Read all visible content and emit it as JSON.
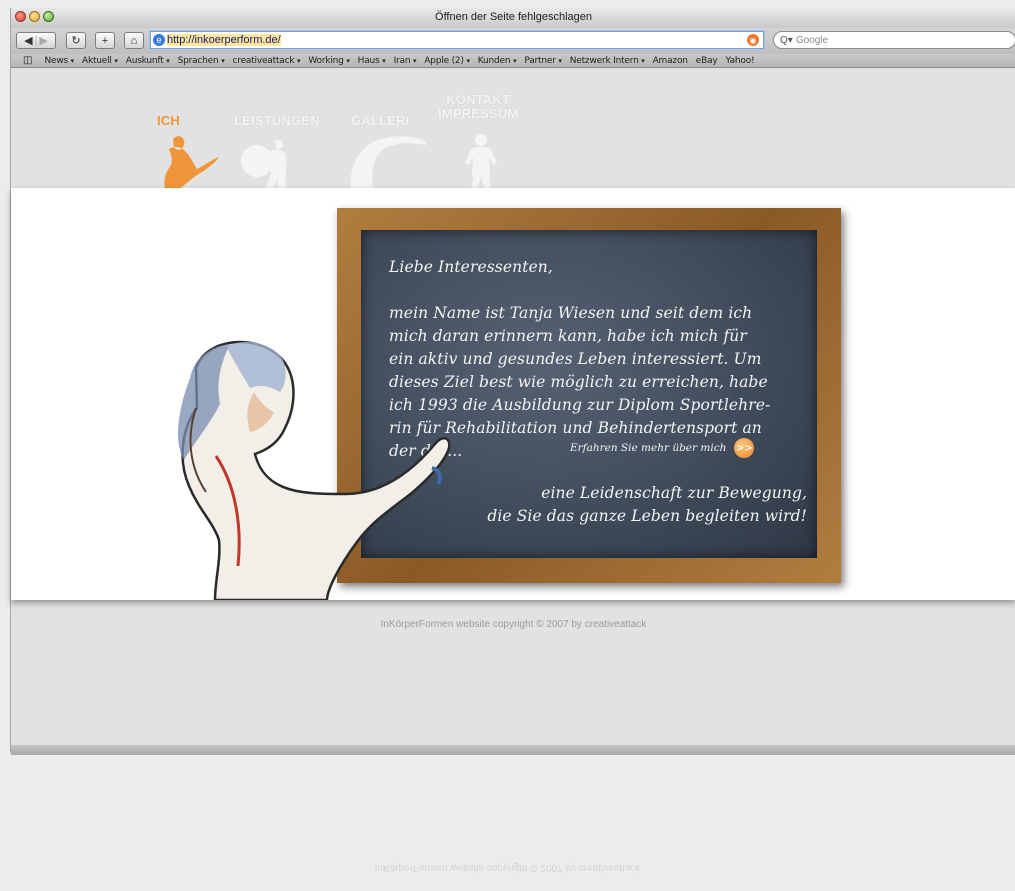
{
  "window": {
    "title": "Öffnen der Seite fehlgeschlagen"
  },
  "toolbar": {
    "url": "http://inkoerperform.de/",
    "search_placeholder": "Google"
  },
  "bookmarks": [
    "News",
    "Aktuell",
    "Auskunft",
    "Sprachen",
    "creativeattack",
    "Working",
    "Haus",
    "Iran",
    "Apple (2)",
    "Kunden",
    "Partner",
    "Netzwerk Intern",
    "Amazon",
    "eBay",
    "Yahoo!"
  ],
  "nav": {
    "ich": "ICH",
    "leistungen": "LEISTUNGEN",
    "galleri": "GALLERI",
    "kontakt": "KONTAKT",
    "impressum": "IMPRESSUM"
  },
  "board": {
    "greeting": "Liebe Interessenten,",
    "lines": [
      "mein Name ist Tanja Wiesen und seit dem ich",
      "mich daran erinnern kann, habe ich mich für",
      "ein aktiv und gesundes Leben interessiert. Um",
      "dieses Ziel best wie möglich zu erreichen, habe",
      "ich 1993 die Ausbildung zur Diplom Sportlehre-",
      "rin für Rehabilitation und Behindertensport an",
      "der dt. ..."
    ],
    "more_link": "Erfahren Sie mehr über mich",
    "more_button": ">>",
    "slogan_1": "eine Leidenschaft zur Bewegung,",
    "slogan_2": "die Sie das ganze Leben begleiten wird!"
  },
  "footer": {
    "copyright": "InKörperFormen website copyright © 2007 by creativeattack"
  },
  "colors": {
    "accent": "#f0963a",
    "board_frame": "#9a6a32",
    "slate": "#3a4554"
  },
  "icons": {
    "back": "back-icon",
    "forward": "forward-icon",
    "reload": "reload-icon",
    "add": "add-icon",
    "home": "home-icon"
  }
}
